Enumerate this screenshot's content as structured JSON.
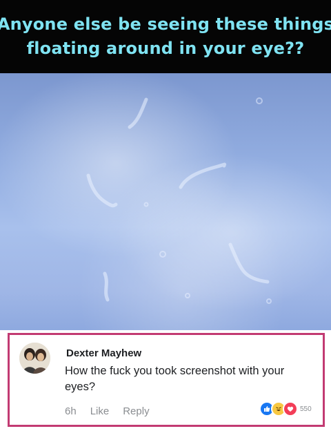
{
  "caption": {
    "line1": "Anyone else be seeing these things",
    "line2": "floating around in your eye??"
  },
  "comment": {
    "author": "Dexter Mayhew",
    "text": "How the fuck you took screenshot with your eyes?",
    "time": "6h",
    "like_label": "Like",
    "reply_label": "Reply",
    "reactions": [
      "like-icon",
      "haha-icon",
      "love-icon"
    ],
    "reaction_count": "550"
  },
  "colors": {
    "caption_text": "#7fe3f2",
    "header_bg": "#050505",
    "highlight_border": "#c23a72",
    "like_blue": "#1877f2",
    "haha_yellow": "#f7c843",
    "love_red": "#f33e58"
  }
}
